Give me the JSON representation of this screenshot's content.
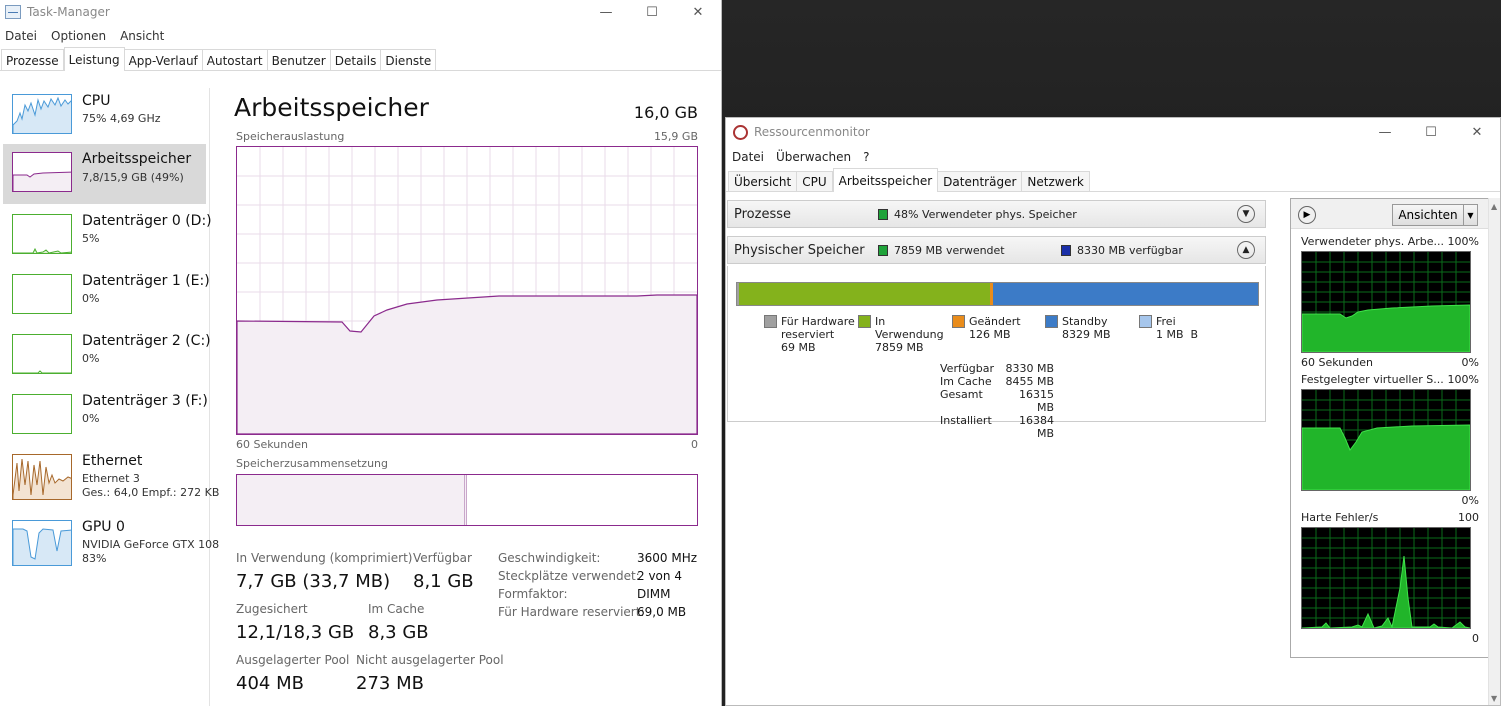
{
  "task_manager": {
    "title": "Task-Manager",
    "menu": [
      "Datei",
      "Optionen",
      "Ansicht"
    ],
    "tabs": [
      "Prozesse",
      "Leistung",
      "App-Verlauf",
      "Autostart",
      "Benutzer",
      "Details",
      "Dienste"
    ],
    "active_tab": "Leistung",
    "sidebar": [
      {
        "name": "CPU",
        "line2": "75% 4,69 GHz",
        "line3": "",
        "color": "#4a9ad8"
      },
      {
        "name": "Arbeitsspeicher",
        "line2": "7,8/15,9 GB (49%)",
        "line3": "",
        "color": "#8b2a8d"
      },
      {
        "name": "Datenträger 0 (D:)",
        "line2": "5%",
        "line3": "",
        "color": "#4caf30"
      },
      {
        "name": "Datenträger 1 (E:)",
        "line2": "0%",
        "line3": "",
        "color": "#4caf30"
      },
      {
        "name": "Datenträger 2 (C:)",
        "line2": "0%",
        "line3": "",
        "color": "#4caf30"
      },
      {
        "name": "Datenträger 3 (F:)",
        "line2": "0%",
        "line3": "",
        "color": "#4caf30"
      },
      {
        "name": "Ethernet",
        "line2": "Ethernet 3",
        "line3": "Ges.: 64,0 Empf.: 272 KB",
        "color": "#a7682b"
      },
      {
        "name": "GPU 0",
        "line2": "NVIDIA GeForce GTX 108",
        "line3": "83%",
        "color": "#4a9ad8"
      }
    ],
    "main": {
      "title": "Arbeitsspeicher",
      "total": "16,0 GB",
      "graph_label": "Speicherauslastung",
      "graph_max": "15,9 GB",
      "graph_left": "60 Sekunden",
      "graph_right": "0",
      "composition_label": "Speicherzusammensetzung",
      "stats": {
        "in_use_label": "In Verwendung (komprimiert)",
        "in_use_value": "7,7 GB (33,7 MB)",
        "available_label": "Verfügbar",
        "available_value": "8,1 GB",
        "committed_label": "Zugesichert",
        "committed_value": "12,1/18,3 GB",
        "cached_label": "Im Cache",
        "cached_value": "8,3 GB",
        "paged_label": "Ausgelagerter Pool",
        "paged_value": "404 MB",
        "nonpaged_label": "Nicht ausgelagerter Pool",
        "nonpaged_value": "273 MB"
      },
      "details": [
        {
          "label": "Geschwindigkeit:",
          "value": "3600 MHz"
        },
        {
          "label": "Steckplätze verwendet:",
          "value": "2 von 4"
        },
        {
          "label": "Formfaktor:",
          "value": "DIMM"
        },
        {
          "label": "Für Hardware reserviert:",
          "value": "69,0 MB"
        }
      ]
    }
  },
  "resource_monitor": {
    "title": "Ressourcenmonitor",
    "menu": [
      "Datei",
      "Überwachen",
      "?"
    ],
    "tabs": [
      "Übersicht",
      "CPU",
      "Arbeitsspeicher",
      "Datenträger",
      "Netzwerk"
    ],
    "active_tab": "Arbeitsspeicher",
    "processes": {
      "label": "Prozesse",
      "info": "48% Verwendeter phys. Speicher"
    },
    "physical": {
      "label": "Physischer Speicher",
      "used_info": "7859 MB verwendet",
      "free_info": "8330 MB verfügbar",
      "legend": [
        {
          "label": "Für Hardware\nreserviert",
          "value": "69 MB",
          "color": "#a0a0a0"
        },
        {
          "label": "In\nVerwendung",
          "value": "7859 MB",
          "color": "#84b21c"
        },
        {
          "label": "Geändert",
          "value": "126 MB",
          "color": "#e98c1b"
        },
        {
          "label": "Standby",
          "value": "8329 MB",
          "color": "#3c7bc7"
        },
        {
          "label": "Frei",
          "value": "1 MB  B",
          "color": "#a6c6ec"
        }
      ],
      "summary": [
        {
          "k": "Verfügbar",
          "v": "8330 MB"
        },
        {
          "k": "Im Cache",
          "v": "8455 MB"
        },
        {
          "k": "Gesamt",
          "v": "16315 MB"
        },
        {
          "k": "Installiert",
          "v": "16384 MB"
        }
      ]
    },
    "views_button": "Ansichten",
    "graphs": [
      {
        "title": "Verwendeter phys. Arbe...",
        "max": "100%",
        "left": "60 Sekunden",
        "min": "0%"
      },
      {
        "title": "Festgelegter virtueller S...",
        "max": "100%",
        "left": "",
        "min": "0%"
      },
      {
        "title": "Harte Fehler/s",
        "max": "100",
        "left": "",
        "min": "0"
      }
    ]
  }
}
